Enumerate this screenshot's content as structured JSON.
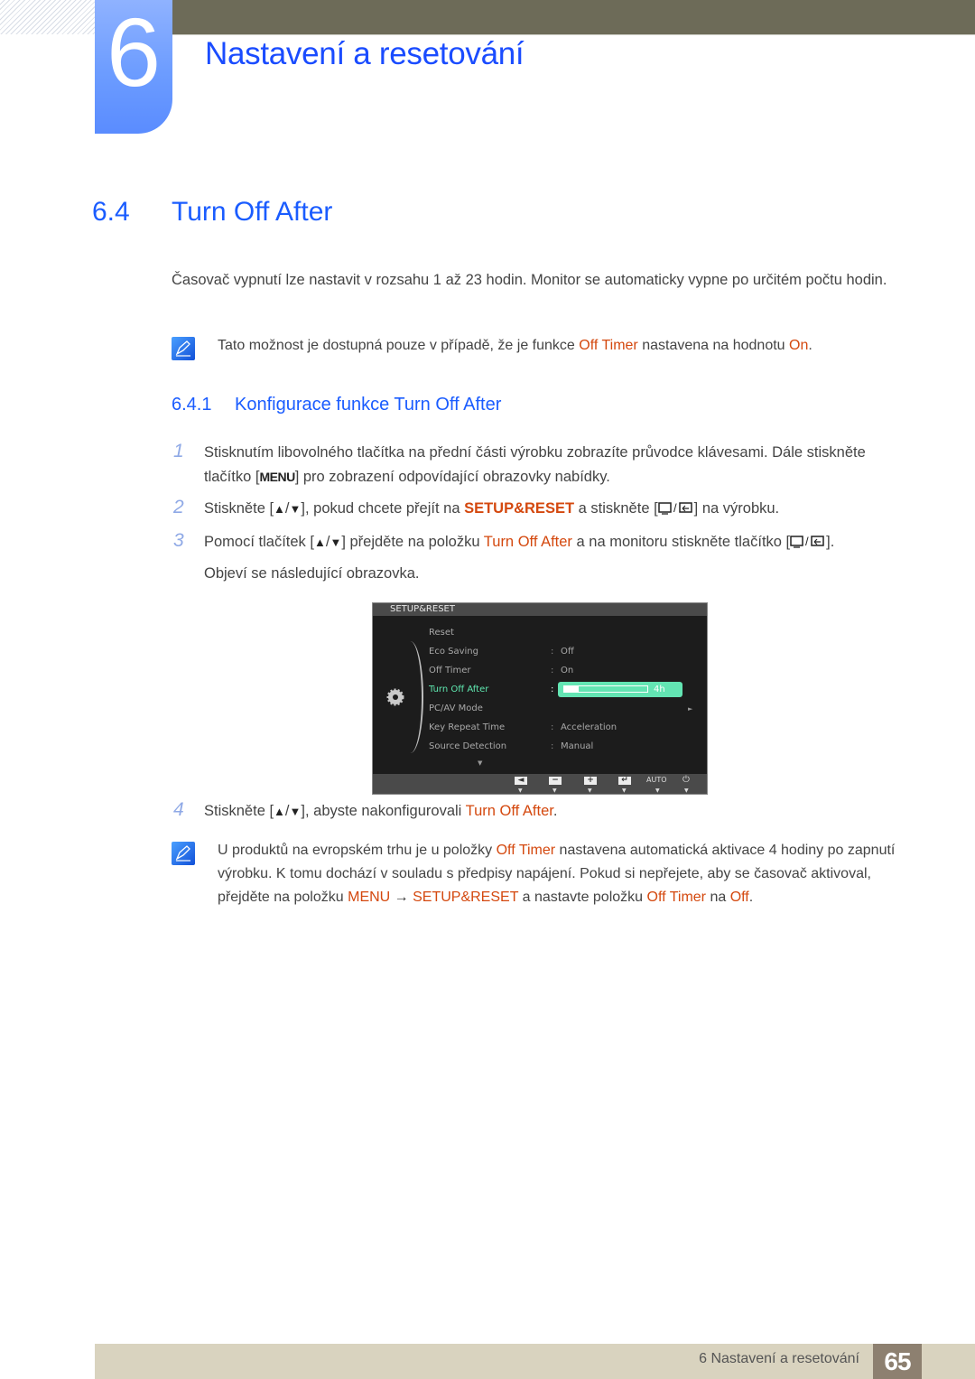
{
  "chapter": {
    "number": "6",
    "title": "Nastavení a resetování"
  },
  "section": {
    "number": "6.4",
    "title": "Turn Off After"
  },
  "intro": {
    "text": "Časovač vypnutí lze nastavit v rozsahu 1 až 23 hodin. Monitor se automaticky vypne po určitém počtu hodin."
  },
  "note1": {
    "icon": "note-pencil-icon",
    "before": "Tato možnost je dostupná pouze v případě, že je funkce ",
    "hl1": "Off Timer",
    "middle": " nastavena na hodnotu ",
    "hl2": "On",
    "after": "."
  },
  "subsection": {
    "number": "6.4.1",
    "title": "Konfigurace funkce Turn Off After"
  },
  "steps": [
    {
      "num": "1",
      "part1": "Stisknutím libovolného tlačítka na přední části výrobku zobrazíte průvodce klávesami. Dále stiskněte tlačítko [",
      "key": "MENU",
      "part2": "] pro zobrazení odpovídající obrazovky nabídky."
    },
    {
      "num": "2",
      "part1": "Stiskněte [",
      "up": "▲",
      "slash": "/",
      "down": "▼",
      "part2": "], pokud chcete přejít na ",
      "hl": "SETUP&RESET",
      "part3": " a stiskněte [",
      "part4": "] na výrobku."
    },
    {
      "num": "3",
      "part1": "Pomocí tlačítek [",
      "up": "▲",
      "slash": "/",
      "down": "▼",
      "part2": "] přejděte na položku ",
      "hl": "Turn Off After",
      "part3": " a na monitoru stiskněte tlačítko [",
      "part4": "].",
      "line2": "Objeví se následující obrazovka."
    },
    {
      "num": "4",
      "part1": "Stiskněte [",
      "up": "▲",
      "slash": "/",
      "down": "▼",
      "part2": "], abyste nakonfigurovali ",
      "hl": "Turn Off After",
      "part3": "."
    }
  ],
  "osd": {
    "header": "SETUP&RESET",
    "items": [
      {
        "label": "Reset",
        "sep": "",
        "value": ""
      },
      {
        "label": "Eco Saving",
        "sep": ":",
        "value": "Off"
      },
      {
        "label": "Off Timer",
        "sep": ":",
        "value": "On"
      },
      {
        "label": "Turn Off After",
        "sep": ":",
        "value": "4h",
        "slider_fraction": 0.17,
        "active": true
      },
      {
        "label": "PC/AV Mode",
        "sep": "",
        "value": "",
        "arrow": "►"
      },
      {
        "label": "Key Repeat Time",
        "sep": ":",
        "value": "Acceleration"
      },
      {
        "label": "Source Detection",
        "sep": ":",
        "value": "Manual"
      }
    ],
    "more_indicator": "▼",
    "buttons": [
      {
        "name": "left",
        "glyph": "◄"
      },
      {
        "name": "minus",
        "glyph": "−"
      },
      {
        "name": "plus",
        "glyph": "+"
      },
      {
        "name": "enter",
        "glyph": "↵"
      },
      {
        "name": "auto",
        "glyph": "AUTO"
      },
      {
        "name": "power",
        "glyph": "⏻"
      }
    ],
    "tick": "▼",
    "accent_color": "#63e5b3"
  },
  "note2": {
    "icon": "note-pencil-icon",
    "t1": "U produktů na evropském trhu je u položky ",
    "hl1": "Off Timer",
    "t2": " nastavena automatická aktivace 4 hodiny po zapnutí výrobku. K tomu dochází v souladu s předpisy napájení. Pokud si nepřejete, aby se časovač aktivoval, přejděte na položku ",
    "hl2": "MENU",
    "arrow": " → ",
    "hl3": "SETUP&RESET",
    "t3": " a nastavte položku ",
    "hl4": "Off Timer",
    "t4": " na ",
    "hl5": "Off",
    "t5": "."
  },
  "footer": {
    "chapter_label": "6 Nastavení a resetování",
    "page_number": "65"
  },
  "colors": {
    "heading_blue": "#1a5cff",
    "highlight_orange": "#d4480e",
    "footer_bg": "#d9d3bf",
    "page_box": "#8d8070",
    "topbar": "#6d6b58"
  }
}
